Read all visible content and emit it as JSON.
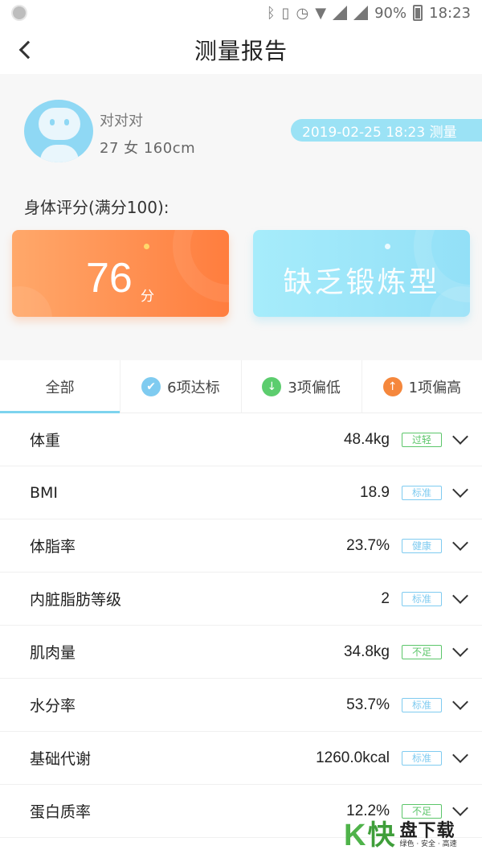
{
  "status_bar": {
    "battery": "90%",
    "time": "18:23",
    "icons": [
      "bluetooth-icon",
      "vibrate-icon",
      "alarm-icon",
      "wifi-icon",
      "cell-signal-icon",
      "cell-signal-icon",
      "battery-icon"
    ]
  },
  "header": {
    "title": "测量报告",
    "back_icon": "chevron-left-icon"
  },
  "profile": {
    "name": "对对对",
    "info": "27 女 160cm",
    "measure_time": "2019-02-25 18:23 测量"
  },
  "score": {
    "label": "身体评分(满分100):",
    "value": "76",
    "unit": "分",
    "body_type": "缺乏锻炼型"
  },
  "tabs": [
    {
      "label": "全部",
      "icon": "",
      "active": true
    },
    {
      "label": "6项达标",
      "icon": "check-icon",
      "color": "#7fcbf0"
    },
    {
      "label": "3项偏低",
      "icon": "arrow-down-icon",
      "color": "#5ccd6e"
    },
    {
      "label": "1项偏高",
      "icon": "arrow-up-icon",
      "color": "#f5873c"
    }
  ],
  "metrics": [
    {
      "label": "体重",
      "value": "48.4kg",
      "status": "过轻",
      "status_color": "#5cc66a"
    },
    {
      "label": "BMI",
      "value": "18.9",
      "status": "标准",
      "status_color": "#7fcbf0"
    },
    {
      "label": "体脂率",
      "value": "23.7%",
      "status": "健康",
      "status_color": "#7fcbf0"
    },
    {
      "label": "内脏脂肪等级",
      "value": "2",
      "status": "标准",
      "status_color": "#7fcbf0"
    },
    {
      "label": "肌肉量",
      "value": "34.8kg",
      "status": "不足",
      "status_color": "#5cc66a"
    },
    {
      "label": "水分率",
      "value": "53.7%",
      "status": "标准",
      "status_color": "#7fcbf0"
    },
    {
      "label": "基础代谢",
      "value": "1260.0kcal",
      "status": "标准",
      "status_color": "#7fcbf0"
    },
    {
      "label": "蛋白质率",
      "value": "12.2%",
      "status": "不足",
      "status_color": "#5cc66a"
    }
  ],
  "watermark": {
    "letter": "K",
    "char": "快",
    "title": "盘下载",
    "subtitle": "绿色 · 安全 · 高速"
  }
}
